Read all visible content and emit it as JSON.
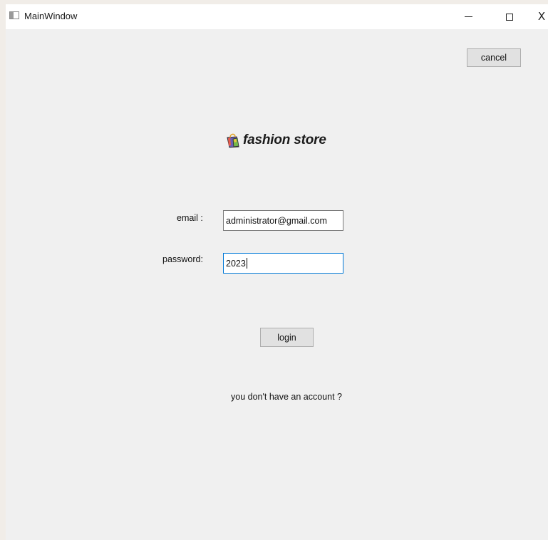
{
  "window": {
    "title": "MainWindow",
    "controls": {
      "minimize_icon": "minimize-icon",
      "maximize_icon": "maximize-icon",
      "close_icon": "close-icon",
      "close_glyph": "X"
    }
  },
  "header": {
    "cancel_label": "cancel"
  },
  "logo": {
    "icon": "shopping-bag-icon",
    "brand_name": "fashion store"
  },
  "form": {
    "email_label": "email :",
    "email_value": "administrator@gmail.com",
    "password_label": "password:",
    "password_value": "2023",
    "login_label": "login"
  },
  "footer": {
    "account_text": "you don't have an account  ?"
  },
  "colors": {
    "window_background": "#f0f0f0",
    "titlebar_background": "#ffffff",
    "focused_border": "#0078d7",
    "button_background": "#e1e1e1"
  }
}
